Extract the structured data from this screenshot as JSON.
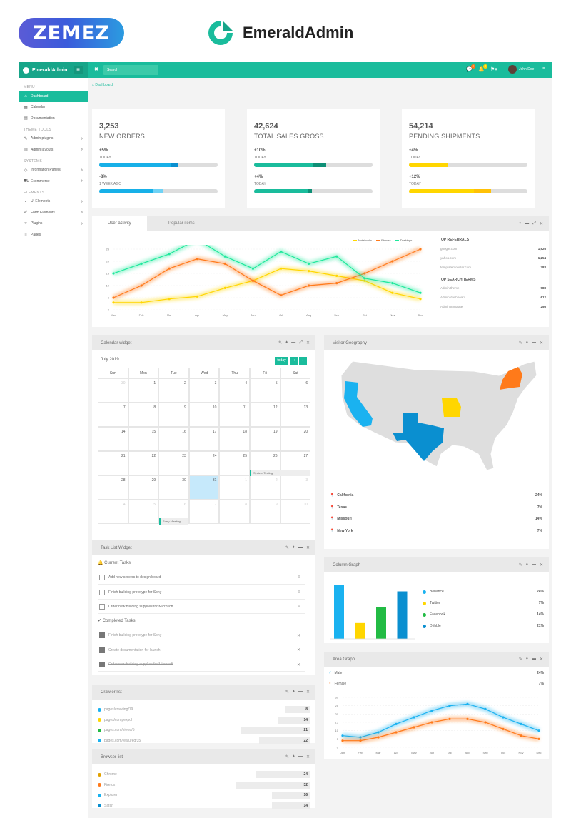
{
  "promo": {
    "zemez": "ZEMEZ",
    "title": "EmeraldAdmin"
  },
  "topbar": {
    "brand": "EmeraldAdmin",
    "search_placeholder": "Search",
    "user": "John Doe",
    "msg_badge": "2",
    "bell_badge": "2"
  },
  "sidebar": {
    "menu_label": "MENU",
    "items_main": [
      {
        "label": "Dashboard",
        "icon": "home-icon"
      },
      {
        "label": "Calendar",
        "icon": "calendar-icon"
      },
      {
        "label": "Documentation",
        "icon": "book-icon"
      }
    ],
    "theme_label": "THEME TOOLS",
    "items_theme": [
      {
        "label": "Admin plugins",
        "icon": "brush-icon"
      },
      {
        "label": "Admin layouts",
        "icon": "layout-icon"
      }
    ],
    "systems_label": "SYSTEMS",
    "items_systems": [
      {
        "label": "Information Panels",
        "icon": "diamond-icon"
      },
      {
        "label": "Ecommerce",
        "icon": "cart-icon"
      }
    ],
    "elements_label": "ELEMENTS",
    "items_elements": [
      {
        "label": "UI Elements",
        "icon": "bell-icon"
      },
      {
        "label": "Form Elements",
        "icon": "pencil-icon"
      },
      {
        "label": "Plugins",
        "icon": "code-icon"
      },
      {
        "label": "Pages",
        "icon": "file-icon"
      }
    ]
  },
  "breadcrumb": "Dashboard",
  "stats": [
    {
      "value": "3,253",
      "label": "NEW ORDERS",
      "p1": "+5%",
      "s1": "TODAY",
      "f1": 0.6,
      "f1b": 0.06,
      "p2": "-8%",
      "s2": "1 WEEK AGO",
      "f2": 0.45,
      "f2b": 0.09,
      "c1": "#17b0e8",
      "c2": "#0a8fd0",
      "c3": "#6fd2f5"
    },
    {
      "value": "42,624",
      "label": "TOTAL SALES GROSS",
      "p1": "+10%",
      "s1": "TODAY",
      "f1": 0.5,
      "f1b": 0.11,
      "p2": "+4%",
      "s2": "TODAY",
      "f2": 0.45,
      "f2b": 0.04,
      "c1": "#1abc9c",
      "c2": "#0e8f76",
      "c3": "#0e8f76"
    },
    {
      "value": "54,214",
      "label": "PENDING SHIPMENTS",
      "p1": "+4%",
      "s1": "TODAY",
      "f1": 0.33,
      "f1b": 0,
      "p2": "+12%",
      "s2": "TODAY",
      "f2": 0.55,
      "f2b": 0.14,
      "c1": "#ffd600",
      "c2": "#ffc107",
      "c3": "#ffc107"
    }
  ],
  "activity": {
    "tabs": [
      "User activity",
      "Popular items"
    ],
    "legend": [
      "Notebooks",
      "Phones",
      "Desktops"
    ],
    "top_referrals": "TOP REFERRALS",
    "referrals": [
      {
        "label": "google.com",
        "value": "1,926"
      },
      {
        "label": "yahoo.com",
        "value": "1,254"
      },
      {
        "label": "templatemonster.com",
        "value": "783"
      }
    ],
    "top_search": "TOP SEARCH TERMS",
    "search_terms": [
      {
        "label": "Admin theme",
        "value": "988"
      },
      {
        "label": "Admin dashboard",
        "value": "612"
      },
      {
        "label": "Admin template",
        "value": "256"
      }
    ]
  },
  "chart_data": [
    {
      "type": "line",
      "x": [
        "Jan",
        "Feb",
        "Mar",
        "Apr",
        "May",
        "Jun",
        "Jul",
        "Aug",
        "Sep",
        "Oct",
        "Nov",
        "Dec"
      ],
      "ylim": [
        0,
        25
      ],
      "yticks": [
        "25",
        "20",
        "15",
        "10",
        "5",
        "0"
      ],
      "series": [
        {
          "name": "Notebooks",
          "color": "#ffd600",
          "values": [
            3,
            3,
            4.5,
            5.5,
            9,
            12,
            17,
            16,
            14,
            12,
            7,
            4.5
          ]
        },
        {
          "name": "Phones",
          "color": "#ff7a1a",
          "values": [
            5,
            10,
            17,
            21,
            19,
            12,
            6,
            10,
            11,
            15,
            20,
            25
          ]
        },
        {
          "name": "Desktops",
          "color": "#1ee89c",
          "values": [
            15,
            19,
            23,
            29,
            22,
            17,
            24,
            19,
            22,
            13,
            11,
            7
          ]
        }
      ]
    },
    {
      "type": "bar",
      "categories": [
        "Behance",
        "Twitter",
        "Facebook",
        "Dribble"
      ],
      "values": [
        24,
        7,
        14,
        21
      ],
      "colors": [
        "#1ab2f0",
        "#ffd600",
        "#22bb44",
        "#0a8fd0"
      ],
      "ylim": [
        0,
        30
      ]
    },
    {
      "type": "line",
      "x": [
        "Jan",
        "Feb",
        "Mar",
        "Apr",
        "May",
        "Jun",
        "Jul",
        "Aug",
        "Sep",
        "Oct",
        "Nov",
        "Dec"
      ],
      "ylim": [
        0,
        30
      ],
      "yticks": [
        "30",
        "25",
        "20",
        "15",
        "10",
        "5",
        "0"
      ],
      "series": [
        {
          "name": "Male",
          "color": "#1ab2f0",
          "values": [
            7,
            6,
            9,
            14,
            18,
            22,
            25,
            26,
            23,
            18,
            14,
            10
          ]
        },
        {
          "name": "Female",
          "color": "#ff7a1a",
          "values": [
            4,
            4,
            6,
            9,
            12,
            15,
            17,
            17,
            15,
            11,
            7,
            5
          ]
        }
      ]
    }
  ],
  "calendar": {
    "title": "Calendar widget",
    "month": "July 2019",
    "today": "today",
    "days": [
      "Sun",
      "Mon",
      "Tue",
      "Wed",
      "Thu",
      "Fri",
      "Sat"
    ],
    "weeks": [
      [
        "30",
        "1",
        "2",
        "3",
        "4",
        "5",
        "6"
      ],
      [
        "7",
        "8",
        "9",
        "10",
        "11",
        "12",
        "13"
      ],
      [
        "14",
        "15",
        "16",
        "17",
        "18",
        "19",
        "20"
      ],
      [
        "21",
        "22",
        "23",
        "24",
        "25",
        "26",
        "27"
      ],
      [
        "28",
        "29",
        "30",
        "31",
        "1",
        "2",
        "3"
      ],
      [
        "4",
        "5",
        "6",
        "7",
        "8",
        "9",
        "10"
      ]
    ],
    "events": [
      "System Testing",
      "Sorry Meeting"
    ]
  },
  "geo": {
    "title": "Visitor Geography",
    "rows": [
      {
        "label": "California",
        "value": "24%",
        "color": "#1ab2f0"
      },
      {
        "label": "Texas",
        "value": "7%",
        "color": "#0a8fd0"
      },
      {
        "label": "Missouri",
        "value": "14%",
        "color": "#ffd600"
      },
      {
        "label": "New York",
        "value": "7%",
        "color": "#ff7a1a"
      }
    ]
  },
  "tasks": {
    "title": "Task List Widget",
    "current": "Current Tasks",
    "completed": "Completed Tasks",
    "current_items": [
      "Add new servers to design board",
      "Finish building prototype for Sony",
      "Order new building supplies for Microsoft"
    ],
    "done_items": [
      "Finish building prototype for Sony",
      "Create documentation for launch",
      "Order new building supplies for Microsoft"
    ]
  },
  "column": {
    "title": "Column Graph",
    "rows": [
      {
        "label": "Behance",
        "value": "24%",
        "color": "#1ab2f0"
      },
      {
        "label": "Twitter",
        "value": "7%",
        "color": "#ffd600"
      },
      {
        "label": "Facebook",
        "value": "14%",
        "color": "#22bb44"
      },
      {
        "label": "Dribble",
        "value": "21%",
        "color": "#0a8fd0"
      }
    ]
  },
  "area": {
    "title": "Area Graph",
    "rows": [
      {
        "label": "Male",
        "value": "24%",
        "color": "#1ab2f0"
      },
      {
        "label": "Female",
        "value": "7%",
        "color": "#ff7a1a"
      }
    ]
  },
  "crawler": {
    "title": "Crawler list",
    "rows": [
      {
        "label": "pages/crawling/19",
        "value": "8",
        "color": "#1ab2f0",
        "w": 0.12
      },
      {
        "label": "pages/compexpol",
        "value": "14",
        "color": "#ffd600",
        "w": 0.15
      },
      {
        "label": "pages.com/views/5",
        "value": "21",
        "color": "#22bb44",
        "w": 0.33
      },
      {
        "label": "pages.com/featured/35",
        "value": "22",
        "color": "#1ab2f0",
        "w": 0.24
      }
    ]
  },
  "browser": {
    "title": "Browser list",
    "rows": [
      {
        "label": "Chrome",
        "value": "24",
        "color": "#e2a100",
        "w": 0.26
      },
      {
        "label": "Firefox",
        "value": "32",
        "color": "#ff7a1a",
        "w": 0.35
      },
      {
        "label": "Explorer",
        "value": "16",
        "color": "#1ab2f0",
        "w": 0.18
      },
      {
        "label": "Safari",
        "value": "14",
        "color": "#0a8fd0",
        "w": 0.18
      }
    ]
  }
}
